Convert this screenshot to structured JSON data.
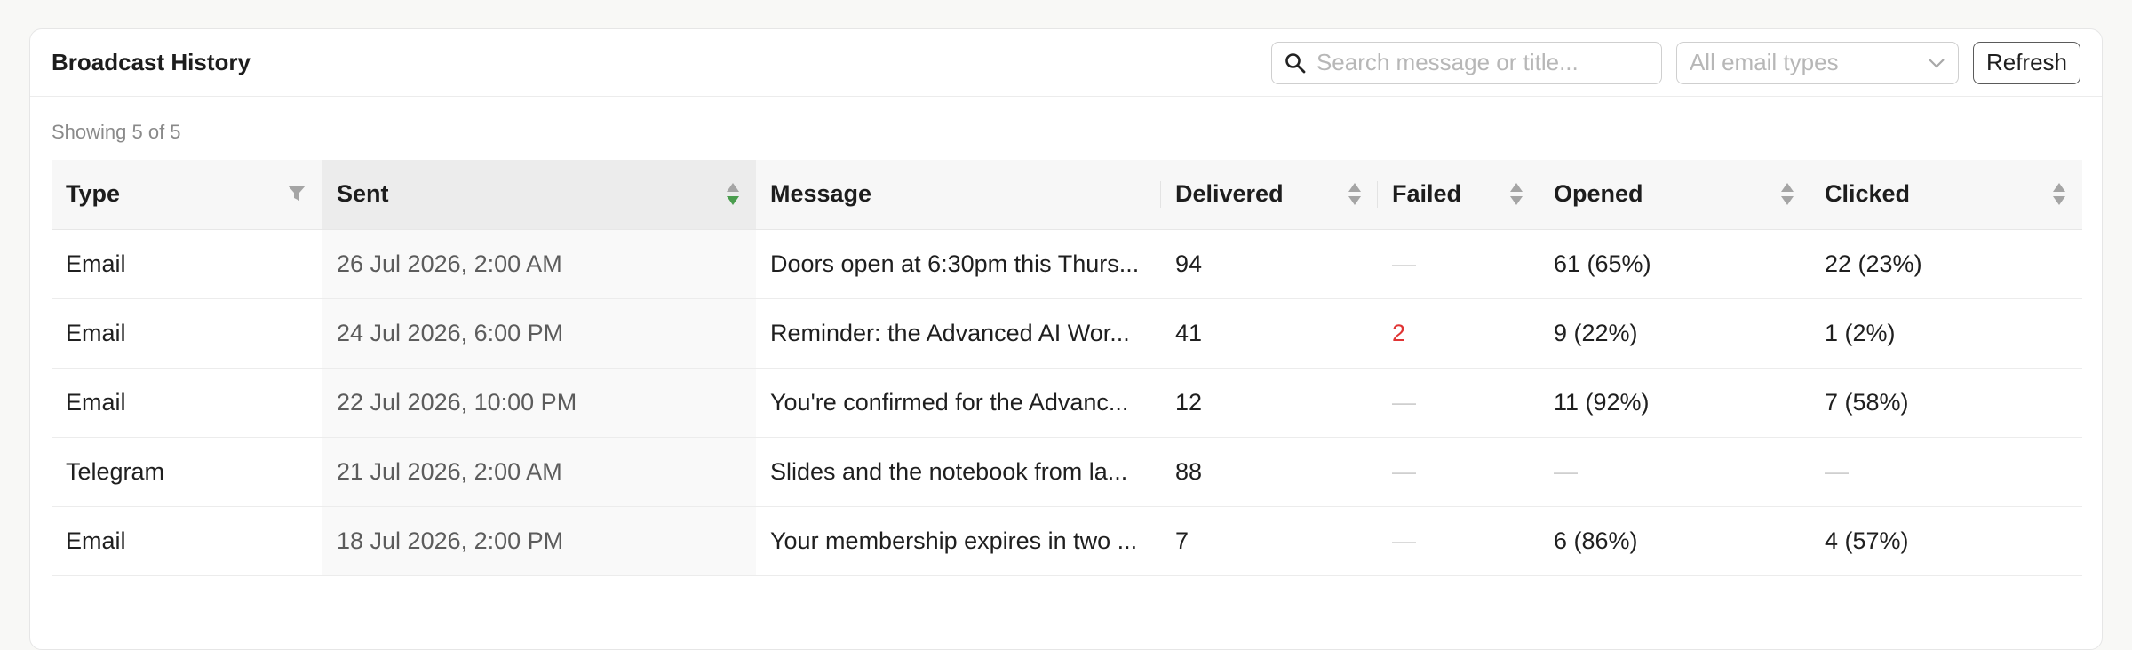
{
  "header": {
    "title": "Broadcast History",
    "search_placeholder": "Search message or title...",
    "type_select": "All email types",
    "refresh_label": "Refresh"
  },
  "summary": "Showing 5 of 5",
  "table": {
    "columns": [
      "Type",
      "Sent",
      "Message",
      "Delivered",
      "Failed",
      "Opened",
      "Clicked"
    ],
    "sorted_column": "Sent",
    "rows": [
      {
        "type": "Email",
        "sent": "26 Jul 2026, 2:00 AM",
        "message": "Doors open at 6:30pm this Thurs...",
        "delivered": "94",
        "failed": "—",
        "opened": "61 (65%)",
        "clicked": "22 (23%)"
      },
      {
        "type": "Email",
        "sent": "24 Jul 2026, 6:00 PM",
        "message": "Reminder: the Advanced AI Wor...",
        "delivered": "41",
        "failed": "2",
        "opened": "9 (22%)",
        "clicked": "1 (2%)"
      },
      {
        "type": "Email",
        "sent": "22 Jul 2026, 10:00 PM",
        "message": "You're confirmed for the Advanc...",
        "delivered": "12",
        "failed": "—",
        "opened": "11 (92%)",
        "clicked": "7 (58%)"
      },
      {
        "type": "Telegram",
        "sent": "21 Jul 2026, 2:00 AM",
        "message": "Slides and the notebook from la...",
        "delivered": "88",
        "failed": "—",
        "opened": "—",
        "clicked": "—"
      },
      {
        "type": "Email",
        "sent": "18 Jul 2026, 2:00 PM",
        "message": "Your membership expires in two ...",
        "delivered": "7",
        "failed": "—",
        "opened": "6 (86%)",
        "clicked": "4 (57%)"
      }
    ]
  },
  "colors": {
    "sort_active": "#4a9d4e",
    "sort_inactive": "#a5a5a5",
    "failed_text": "#e03434"
  }
}
